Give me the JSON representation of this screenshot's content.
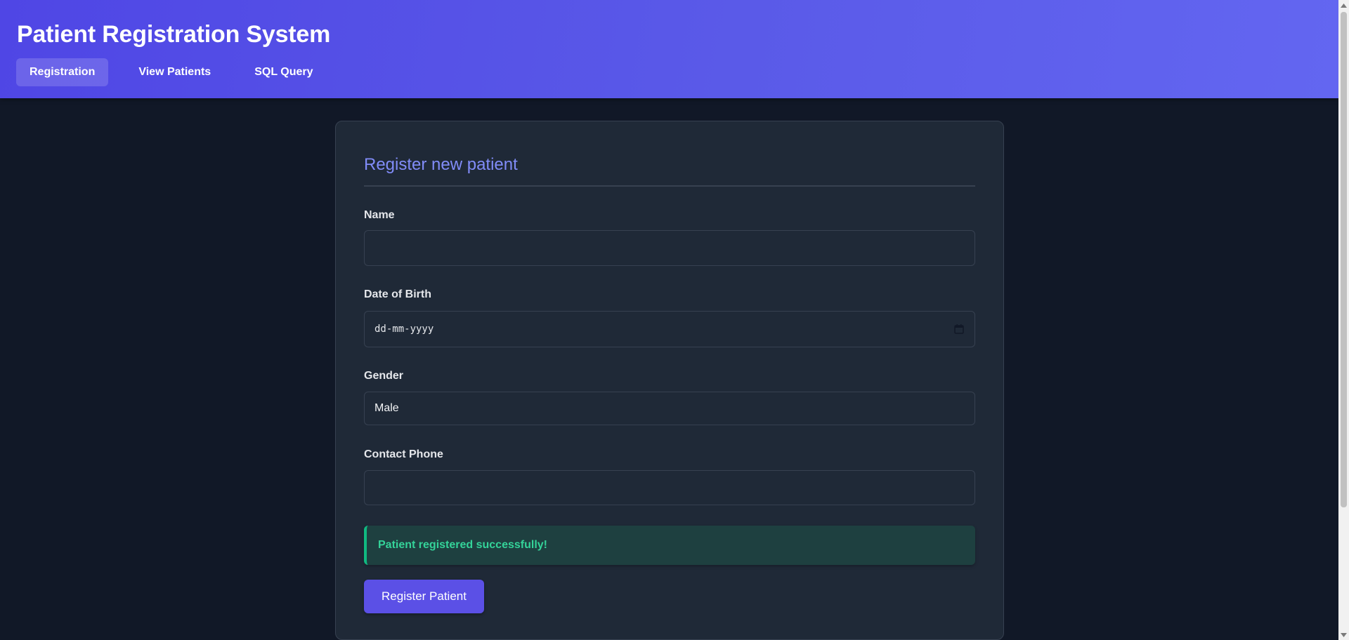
{
  "header": {
    "title": "Patient Registration System",
    "tabs": [
      {
        "label": "Registration",
        "active": true
      },
      {
        "label": "View Patients",
        "active": false
      },
      {
        "label": "SQL Query",
        "active": false
      }
    ]
  },
  "form": {
    "title": "Register new patient",
    "name": {
      "label": "Name",
      "value": "",
      "placeholder": ""
    },
    "dob": {
      "label": "Date of Birth",
      "placeholder": "dd-mm-yyyy"
    },
    "gender": {
      "label": "Gender",
      "value": "Male"
    },
    "phone": {
      "label": "Contact Phone",
      "value": "",
      "placeholder": ""
    },
    "success_message": "Patient registered successfully!",
    "submit_label": "Register Patient"
  },
  "icons": {
    "date_picker": "calendar-icon"
  },
  "colors": {
    "header_gradient_start": "#4f46e5",
    "header_gradient_end": "#6366f1",
    "page_background": "#111827",
    "card_background": "#1f2937",
    "title_accent": "#818cf8",
    "success_text": "#34d399",
    "success_border": "#10b981",
    "button": "#5b50e6"
  }
}
